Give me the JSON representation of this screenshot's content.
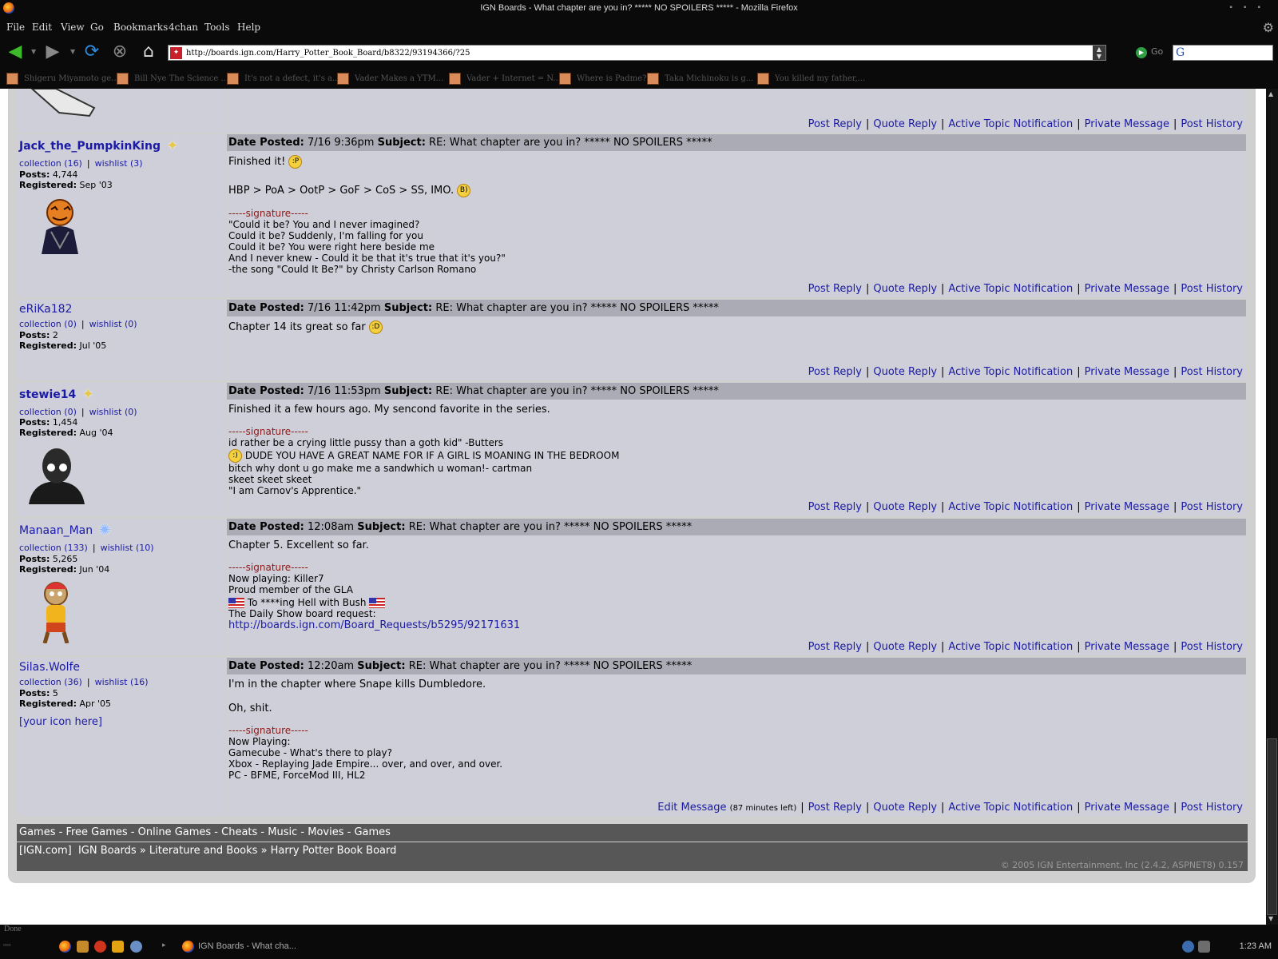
{
  "window": {
    "title": "IGN Boards - What chapter are you in? ***** NO SPOILERS ***** - Mozilla Firefox"
  },
  "menu": [
    "File",
    "Edit",
    "View",
    "Go",
    "Bookmarks",
    "4chan",
    "Tools",
    "Help"
  ],
  "nav": {
    "url": "http://boards.ign.com/Harry_Potter_Book_Board/b8322/93194366/?25",
    "go_label": "Go"
  },
  "bookmarks": [
    "Shigeru Miyamoto ge...",
    "Bill Nye The Science ...",
    "It's not a defect, it's a...",
    "Vader Makes a YTM...",
    "Vader + Internet = N...",
    "Where is Padme?",
    "Taka Michinoku is g...",
    "You killed my father,..."
  ],
  "actions": {
    "post_reply": "Post Reply",
    "quote_reply": "Quote Reply",
    "active_topic": "Active Topic Notification",
    "private_message": "Private Message",
    "post_history": "Post History",
    "edit_message": "Edit Message",
    "edit_note": "(87 minutes left)",
    "sep": "|"
  },
  "labels": {
    "date_posted": "Date Posted:",
    "subject": "Subject:",
    "posts": "Posts:",
    "registered": "Registered:",
    "signature": "-----signature-----"
  },
  "subject_text": "RE: What chapter are you in? ***** NO SPOILERS *****",
  "posts": [
    {
      "username": "Jack_the_PumpkinKing",
      "collection": "collection (16)",
      "wishlist": "wishlist (3)",
      "posts": "4,744",
      "registered": "Sep '03",
      "date": "7/16 9:36pm",
      "body": [
        "Finished it!",
        "HBP > PoA > OotP > GoF > CoS > SS, IMO."
      ],
      "signature": [
        "\"Could it be? You and I never imagined?",
        "Could it be? Suddenly, I'm falling for you",
        "Could it be? You were right here beside me",
        "And I never knew - Could it be that it's true that it's you?\"",
        "-the song \"Could It Be?\" by Christy Carlson Romano"
      ]
    },
    {
      "username": "eRiKa182",
      "collection": "collection (0)",
      "wishlist": "wishlist (0)",
      "posts": "2",
      "registered": "Jul '05",
      "date": "7/16 11:42pm",
      "body": [
        "Chapter 14 its great so far"
      ]
    },
    {
      "username": "stewie14",
      "collection": "collection (0)",
      "wishlist": "wishlist (0)",
      "posts": "1,454",
      "registered": "Aug '04",
      "date": "7/16 11:53pm",
      "body": [
        "Finished it a few hours ago. My sencond favorite in the series."
      ],
      "signature": [
        "id rather be a crying little pussy than a goth kid\" -Butters",
        "DUDE YOU HAVE A GREAT NAME FOR IF A GIRL IS MOANING IN THE BEDROOM",
        "bitch why dont u go make me a sandwhich u woman!- cartman",
        "skeet skeet skeet",
        "\"I am Carnov's Apprentice.\""
      ]
    },
    {
      "username": "Manaan_Man",
      "collection": "collection (133)",
      "wishlist": "wishlist (10)",
      "posts": "5,265",
      "registered": "Jun '04",
      "date": "12:08am",
      "body": [
        "Chapter 5. Excellent so far."
      ],
      "signature": [
        "Now playing: Killer7",
        "Proud member of the GLA",
        "To ****ing Hell with Bush",
        "The Daily Show board request:",
        "http://boards.ign.com/Board_Requests/b5295/92171631"
      ]
    },
    {
      "username": "Silas.Wolfe",
      "collection": "collection (36)",
      "wishlist": "wishlist (16)",
      "posts": "5",
      "registered": "Apr '05",
      "avatar_text": "[your icon here]",
      "date": "12:20am",
      "body": [
        "I'm in the chapter where Snape kills Dumbledore.",
        "Oh, shit."
      ],
      "signature": [
        "Now Playing:",
        "Gamecube - What's there to play?",
        "Xbox - Replaying Jade Empire... over, and over, and over.",
        "PC - BFME, ForceMod III, HL2"
      ]
    }
  ],
  "footer": {
    "links": [
      "Games",
      "Free Games",
      "Online Games",
      "Cheats",
      "Music",
      "Movies",
      "Games"
    ],
    "link_sep": " - ",
    "crumb": [
      "[IGN.com]",
      "IGN Boards",
      "Literature and Books",
      "Harry Potter Book Board"
    ],
    "crumb_sep": " » ",
    "copyright": "© 2005 IGN Entertainment, Inc (2.4.2, ASPNET8) 0.157"
  },
  "status": "Done",
  "taskbar": {
    "task": "IGN Boards - What cha...",
    "clock": "1:23 AM"
  }
}
